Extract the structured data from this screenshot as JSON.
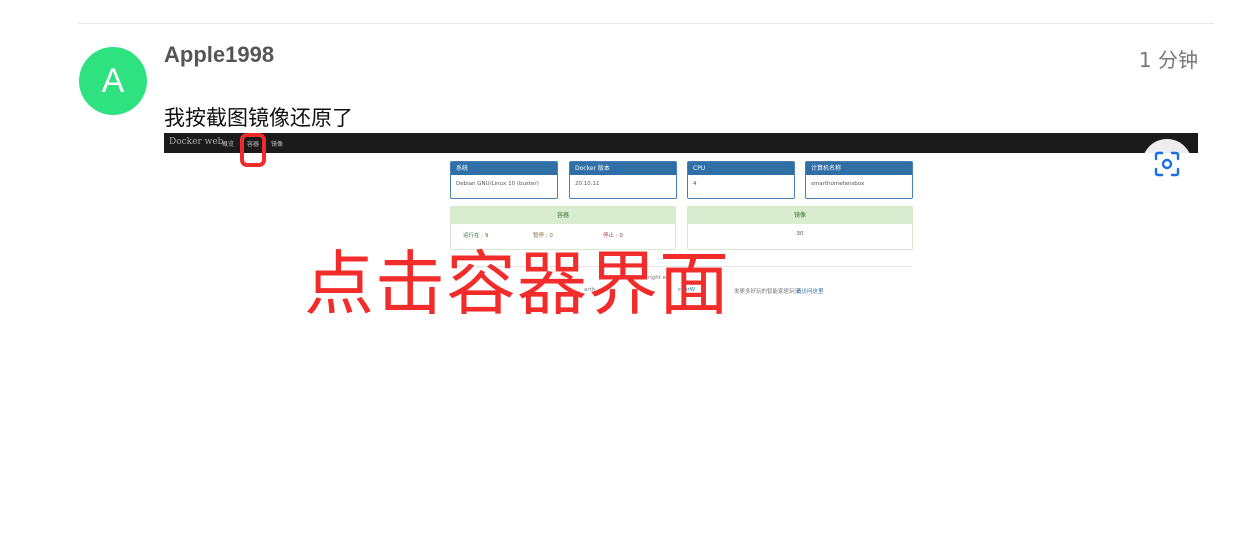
{
  "comment": {
    "avatar_letter": "A",
    "username": "Apple1998",
    "time": "1 分钟",
    "text": "我按截图镜像还原了"
  },
  "screenshot": {
    "nav": {
      "brand": "Docker web",
      "items": [
        "概览",
        "容器",
        "镜像"
      ]
    },
    "info_cards": [
      {
        "title": "系统",
        "value": "Debian GNU/Linux 10 (buster)"
      },
      {
        "title": "Docker 版本",
        "value": "20.10.11"
      },
      {
        "title": "CPU",
        "value": "4"
      },
      {
        "title": "计算机名称",
        "value": "smarthomefansbox"
      }
    ],
    "containers": {
      "title": "容器",
      "running": "运行在 : 9",
      "paused": "暂停 : 0",
      "stopped": "停止 : 0"
    },
    "images": {
      "title": "镜像",
      "count": "30"
    },
    "footer": {
      "line1": "right ed",
      "line2_a": "arth",
      "line2_b": "ckerW",
      "line2_c": "发更多好玩的智能家居玩法",
      "line2_d": "请访问这里"
    },
    "annotation": "点击容器界面"
  },
  "colors": {
    "avatar": "#2ee37f",
    "annotation": "#f22b2b",
    "panel_head": "#2f6fa6",
    "success_head": "#d8eccf",
    "navbar": "#1b1b1b"
  },
  "icons": {
    "scan_button": "scan-icon"
  }
}
